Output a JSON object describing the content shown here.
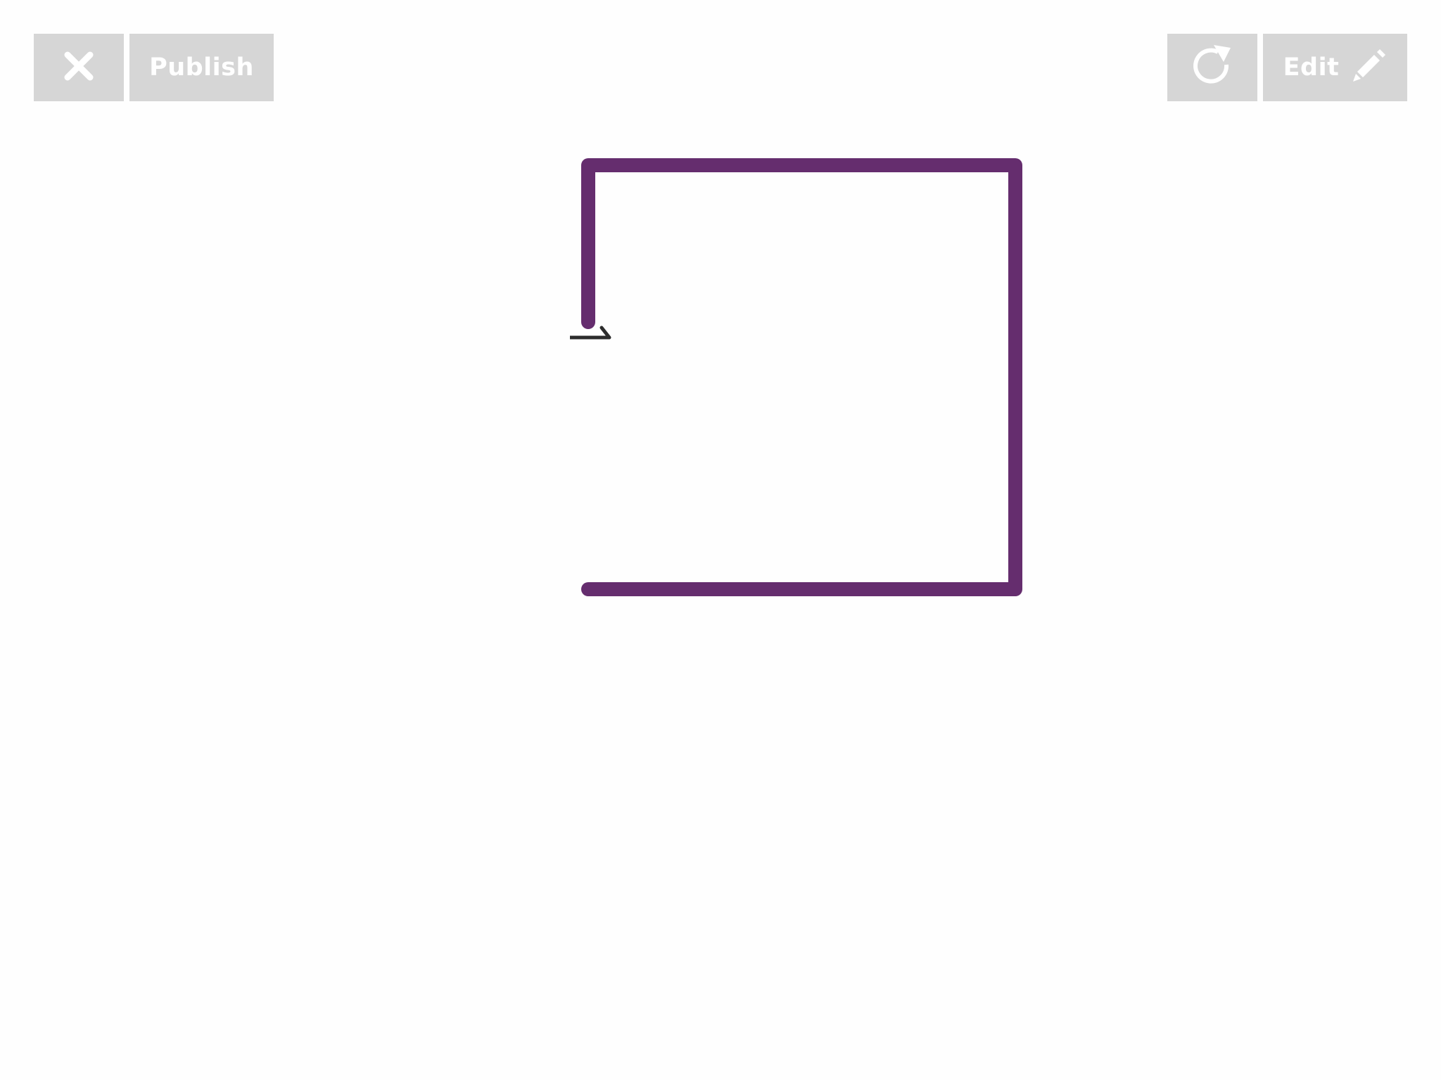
{
  "toolbar": {
    "close_icon": "close-icon",
    "publish_label": "Publish",
    "refresh_icon": "refresh-icon",
    "edit_label": "Edit",
    "edit_icon": "pencil-icon",
    "button_color": "#d6d6d6",
    "icon_color": "#ffffff"
  },
  "drawing": {
    "stroke_color": "#652d6e",
    "marker_color": "#2c2c2c",
    "description_icon": "turtle-start-marker"
  }
}
